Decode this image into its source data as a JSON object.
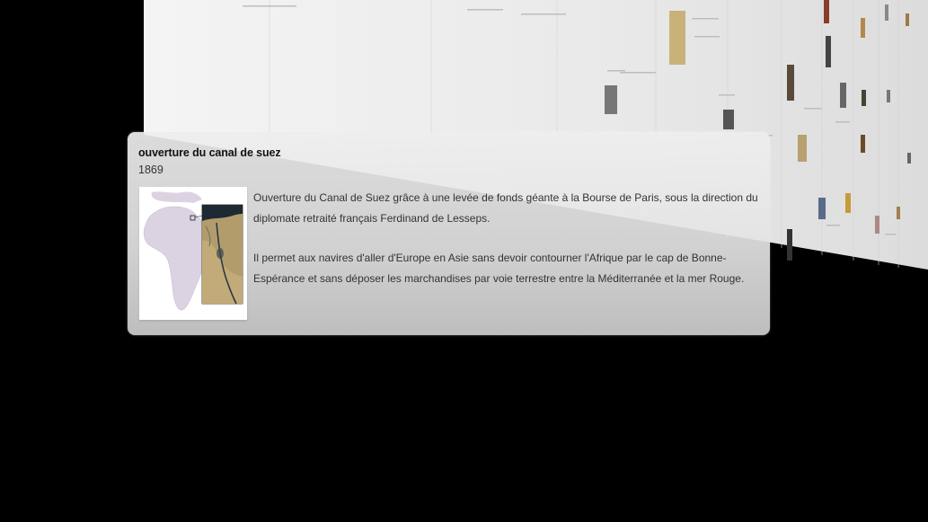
{
  "event": {
    "title": "ouverture du canal de suez",
    "year": "1869",
    "description": [
      "Ouverture du Canal de Suez grâce à une levée de fonds géante à la Bourse de Paris, sous la direction du diplomate retraité français Ferdinand de Lesseps.",
      "Il permet aux navires d'aller d'Europe en Asie sans devoir contourner l'Afrique par le cap de Bonne-Espérance et sans déposer les marchandises par voie terrestre entre la Méditerranée et la mer Rouge."
    ],
    "image_alt_icon": "africa-suez-map-icon"
  },
  "colors": {
    "background": "#000000",
    "card": "#e6e6e6",
    "continent": "#d8cfe0",
    "satellite_land": "#b09a6a",
    "sea": "#1e2a33"
  }
}
